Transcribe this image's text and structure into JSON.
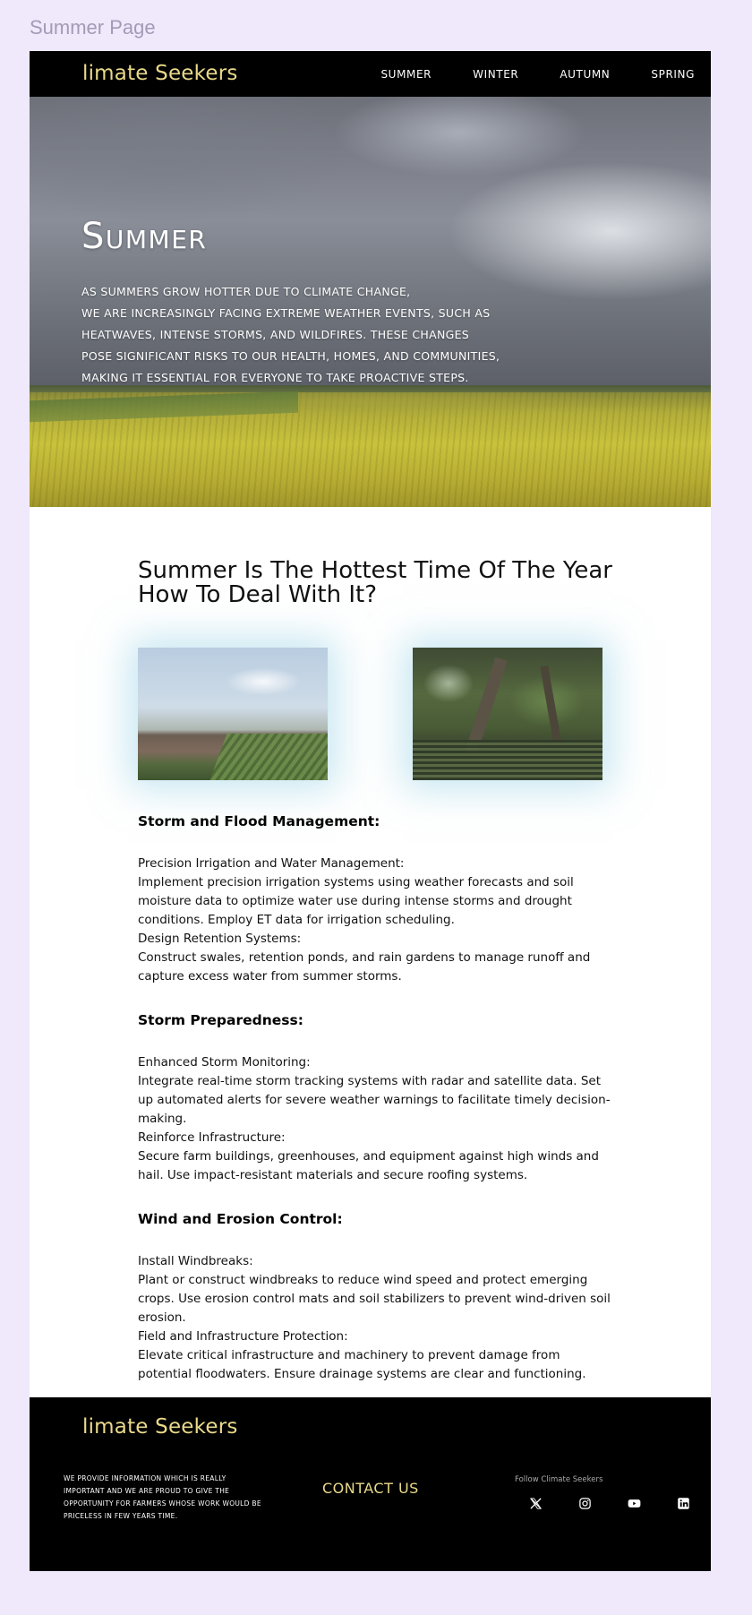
{
  "page_label": "Summer Page",
  "brand": {
    "name": "limate Seekers",
    "moon_color": "#7ec0d8",
    "text_color": "#e9d98a"
  },
  "nav": {
    "items": [
      {
        "label": "SUMMER"
      },
      {
        "label": "WINTER"
      },
      {
        "label": "AUTUMN"
      },
      {
        "label": "SPRING"
      }
    ]
  },
  "hero": {
    "title": "Summer",
    "lines": [
      "AS SUMMERS GROW HOTTER DUE TO CLIMATE CHANGE,",
      "WE ARE INCREASINGLY FACING EXTREME WEATHER EVENTS, SUCH AS",
      "HEATWAVES, INTENSE STORMS, AND WILDFIRES. THESE CHANGES",
      "POSE SIGNIFICANT RISKS TO OUR HEALTH, HOMES, AND COMMUNITIES,",
      "MAKING IT ESSENTIAL FOR EVERYONE TO TAKE PROACTIVE STEPS."
    ]
  },
  "main": {
    "heading_line1": "Summer Is The Hottest Time Of The Year",
    "heading_line2": "How To Deal With It?",
    "sections": [
      {
        "title": "Storm and Flood Management:",
        "lines": [
          "Precision Irrigation and Water Management:",
          "Implement precision irrigation systems using weather forecasts and soil moisture data to optimize water use during intense storms and drought conditions. Employ ET data for irrigation scheduling.",
          "Design Retention Systems:",
          "Construct swales, retention ponds, and rain gardens to manage runoff and capture excess water from summer storms."
        ]
      },
      {
        "title": "Storm Preparedness:",
        "lines": [
          "Enhanced Storm Monitoring:",
          "Integrate real-time storm tracking systems with radar and satellite data. Set up automated alerts for severe weather warnings to facilitate timely decision-making.",
          "Reinforce Infrastructure:",
          "Secure farm buildings, greenhouses, and equipment against high winds and hail. Use impact-resistant materials and secure roofing systems."
        ]
      },
      {
        "title": "Wind and Erosion Control:",
        "lines": [
          "Install Windbreaks:",
          "Plant or construct windbreaks to reduce wind speed and protect emerging crops. Use erosion control mats and soil stabilizers to prevent wind-driven soil erosion.",
          "Field and Infrastructure Protection:",
          "Elevate critical infrastructure and machinery to prevent damage from potential floodwaters. Ensure drainage systems are clear and functioning."
        ]
      }
    ]
  },
  "footer": {
    "about": "We provide information which is really important and we are proud to give the opportunity for farmers whose work would be priceless in few years time.",
    "contact_label": "CONTACT US",
    "follow_label": "Follow Climate Seekers",
    "socials": [
      "x-icon",
      "instagram-icon",
      "youtube-icon",
      "linkedin-icon"
    ]
  }
}
